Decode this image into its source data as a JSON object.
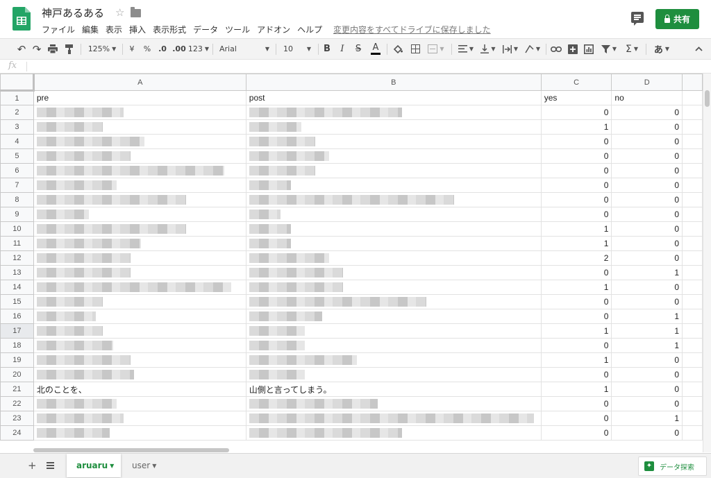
{
  "header": {
    "title": "神戸あるある",
    "menu": [
      "ファイル",
      "編集",
      "表示",
      "挿入",
      "表示形式",
      "データ",
      "ツール",
      "アドオン",
      "ヘルプ"
    ],
    "save_status": "変更内容をすべてドライブに保存しました",
    "share_label": "共有"
  },
  "toolbar": {
    "zoom": "125%",
    "currency": "¥",
    "percent": "%",
    "dec_decrease": ".0",
    "dec_increase": ".00",
    "more_formats": "123",
    "font": "Arial",
    "font_size": "10",
    "bold": "B",
    "italic": "I",
    "strike": "S",
    "text_color": "A",
    "sum": "Σ",
    "input_tools": "あ"
  },
  "formula_bar": {
    "fx": "fx"
  },
  "grid": {
    "columns": [
      "A",
      "B",
      "C",
      "D"
    ],
    "row_numbers": [
      "1",
      "2",
      "3",
      "4",
      "5",
      "6",
      "7",
      "8",
      "9",
      "10",
      "11",
      "12",
      "13",
      "14",
      "15",
      "16",
      "17",
      "18",
      "19",
      "20",
      "21",
      "22",
      "23",
      "24"
    ],
    "selected_row": "17",
    "rows": [
      {
        "a": "pre",
        "b": "post",
        "c": "yes",
        "d": "no",
        "blurA": 0,
        "blurB": 0
      },
      {
        "a": "",
        "b": "",
        "c": "0",
        "d": "0",
        "blurA": 125,
        "blurB": 220
      },
      {
        "a": "",
        "b": "",
        "c": "1",
        "d": "0",
        "blurA": 95,
        "blurB": 75
      },
      {
        "a": "",
        "b": "",
        "c": "0",
        "d": "0",
        "blurA": 155,
        "blurB": 95
      },
      {
        "a": "",
        "b": "",
        "c": "0",
        "d": "0",
        "blurA": 135,
        "blurB": 115
      },
      {
        "a": "",
        "b": "",
        "c": "0",
        "d": "0",
        "blurA": 270,
        "blurB": 95
      },
      {
        "a": "",
        "b": "",
        "c": "0",
        "d": "0",
        "blurA": 115,
        "blurB": 60
      },
      {
        "a": "",
        "b": "",
        "c": "0",
        "d": "0",
        "blurA": 215,
        "blurB": 295
      },
      {
        "a": "",
        "b": "",
        "c": "0",
        "d": "0",
        "blurA": 75,
        "blurB": 45
      },
      {
        "a": "",
        "b": "",
        "c": "1",
        "d": "0",
        "blurA": 215,
        "blurB": 60
      },
      {
        "a": "",
        "b": "",
        "c": "1",
        "d": "0",
        "blurA": 150,
        "blurB": 60
      },
      {
        "a": "",
        "b": "",
        "c": "2",
        "d": "0",
        "blurA": 135,
        "blurB": 115
      },
      {
        "a": "",
        "b": "",
        "c": "0",
        "d": "1",
        "blurA": 135,
        "blurB": 135
      },
      {
        "a": "",
        "b": "",
        "c": "1",
        "d": "0",
        "blurA": 280,
        "blurB": 135
      },
      {
        "a": "",
        "b": "",
        "c": "0",
        "d": "0",
        "blurA": 95,
        "blurB": 255
      },
      {
        "a": "",
        "b": "",
        "c": "0",
        "d": "1",
        "blurA": 85,
        "blurB": 105
      },
      {
        "a": "",
        "b": "",
        "c": "1",
        "d": "1",
        "blurA": 95,
        "blurB": 80
      },
      {
        "a": "",
        "b": "",
        "c": "0",
        "d": "1",
        "blurA": 110,
        "blurB": 80
      },
      {
        "a": "",
        "b": "",
        "c": "1",
        "d": "0",
        "blurA": 135,
        "blurB": 155
      },
      {
        "a": "",
        "b": "",
        "c": "0",
        "d": "0",
        "blurA": 140,
        "blurB": 80
      },
      {
        "a": "北のことを、",
        "b": "山側と言ってしまう。",
        "c": "1",
        "d": "0",
        "blurA": 0,
        "blurB": 0
      },
      {
        "a": "",
        "b": "",
        "c": "0",
        "d": "0",
        "blurA": 115,
        "blurB": 185
      },
      {
        "a": "",
        "b": "",
        "c": "0",
        "d": "1",
        "blurA": 125,
        "blurB": 410
      },
      {
        "a": "",
        "b": "",
        "c": "0",
        "d": "0",
        "blurA": 105,
        "blurB": 220
      }
    ]
  },
  "sheets": [
    {
      "name": "aruaru",
      "active": true
    },
    {
      "name": "user",
      "active": false
    }
  ],
  "explore_label": "データ探索",
  "colors": {
    "accent": "#1e8e3e"
  }
}
